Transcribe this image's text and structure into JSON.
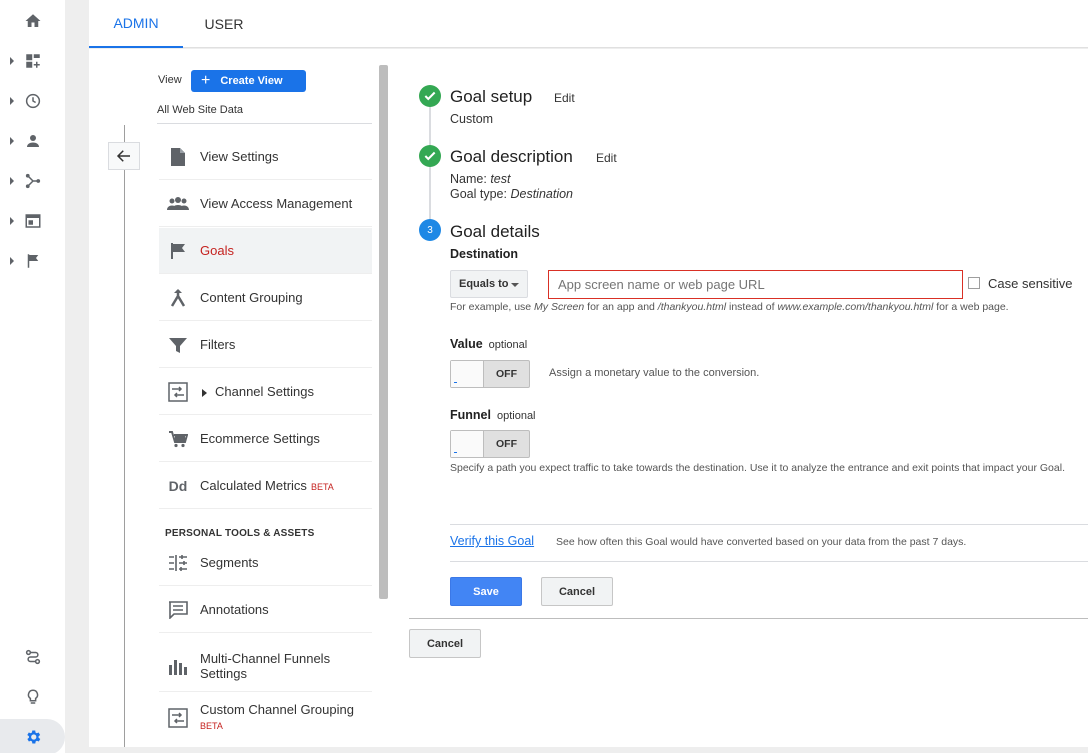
{
  "tabs": {
    "admin": "ADMIN",
    "user": "USER"
  },
  "nav": {
    "view_label": "View",
    "create_view": "Create View",
    "view_name": "All Web Site Data",
    "items": [
      {
        "label": "View Settings",
        "icon": "document-icon"
      },
      {
        "label": "View Access Management",
        "icon": "people-icon"
      },
      {
        "label": "Goals",
        "icon": "flag-icon",
        "active": true
      },
      {
        "label": "Content Grouping",
        "icon": "content-grouping-icon"
      },
      {
        "label": "Filters",
        "icon": "filter-icon"
      },
      {
        "label": "Channel Settings",
        "icon": "channel-icon"
      },
      {
        "label": "Ecommerce Settings",
        "icon": "cart-icon"
      },
      {
        "label": "Calculated Metrics",
        "badge": "BETA",
        "icon": "dd-icon"
      }
    ],
    "personal_heading": "PERSONAL TOOLS & ASSETS",
    "personal_items": [
      {
        "label": "Segments",
        "icon": "segments-icon"
      },
      {
        "label": "Annotations",
        "icon": "annotations-icon"
      },
      {
        "label": "Multi-Channel Funnels Settings",
        "icon": "bar-chart-icon"
      },
      {
        "label": "Custom Channel Grouping",
        "badge": "BETA",
        "icon": "channel-icon"
      }
    ]
  },
  "goal": {
    "setup": {
      "title": "Goal setup",
      "edit": "Edit",
      "value": "Custom"
    },
    "description": {
      "title": "Goal description",
      "edit": "Edit",
      "name_label": "Name:",
      "name_value": "test",
      "type_label": "Goal type:",
      "type_value": "Destination"
    },
    "details": {
      "step": "3",
      "title": "Goal details",
      "destination_label": "Destination",
      "match_type": "Equals to",
      "destination_placeholder": "App screen name or web page URL",
      "case_sensitive": "Case sensitive",
      "hint": {
        "p1": "For example, use ",
        "e1": "My Screen",
        "p2": " for an app and ",
        "e2": "/thankyou.html",
        "p3": " instead of ",
        "e3": "www.example.com/thankyou.html",
        "p4": " for a web page."
      },
      "value_label": "Value",
      "value_optional": "optional",
      "value_toggle": "OFF",
      "value_desc": "Assign a monetary value to the conversion.",
      "funnel_label": "Funnel",
      "funnel_optional": "optional",
      "funnel_toggle": "OFF",
      "funnel_desc": "Specify a path you expect traffic to take towards the destination. Use it to analyze the entrance and exit points that impact your Goal.",
      "verify_link": "Verify this Goal",
      "verify_desc": "See how often this Goal would have converted based on your data from the past 7 days.",
      "save": "Save",
      "cancel": "Cancel"
    },
    "outer_cancel": "Cancel"
  },
  "colors": {
    "accent": "#1a73e8",
    "success": "#34a853",
    "active_nav": "#c5221f",
    "error_border": "#d93025"
  }
}
